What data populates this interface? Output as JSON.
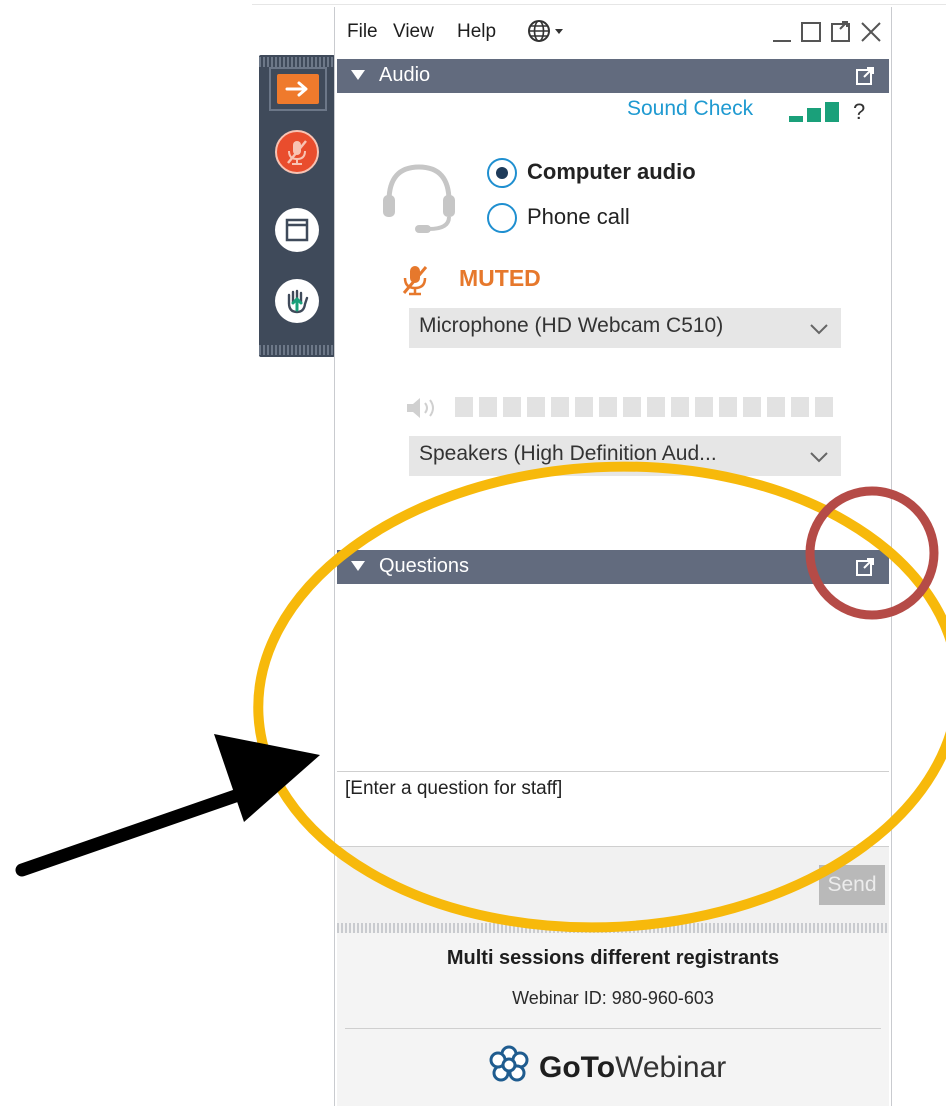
{
  "menu": {
    "file": "File",
    "view": "View",
    "help": "Help"
  },
  "audio": {
    "section_title": "Audio",
    "sound_check": "Sound Check",
    "help_symbol": "?",
    "options": [
      {
        "label": "Computer audio",
        "selected": true
      },
      {
        "label": "Phone call",
        "selected": false
      }
    ],
    "mute_status": "MUTED",
    "microphone": "Microphone (HD Webcam C510)",
    "speakers": "Speakers (High Definition Aud..."
  },
  "questions": {
    "section_title": "Questions",
    "input_placeholder": "[Enter a question for staff]",
    "send_label": "Send"
  },
  "footer": {
    "session_title": "Multi sessions different registrants",
    "webinar_id": "Webinar ID: 980-960-603",
    "brand_bold": "GoTo",
    "brand_rest": "Webinar"
  },
  "colors": {
    "section_bar": "#626b7e",
    "accent_blue": "#1f9ad1",
    "muted_orange": "#e6782c",
    "sidebar": "#3f4a5a",
    "annotation_yellow": "#f7b90b",
    "annotation_red": "#b54b47"
  }
}
